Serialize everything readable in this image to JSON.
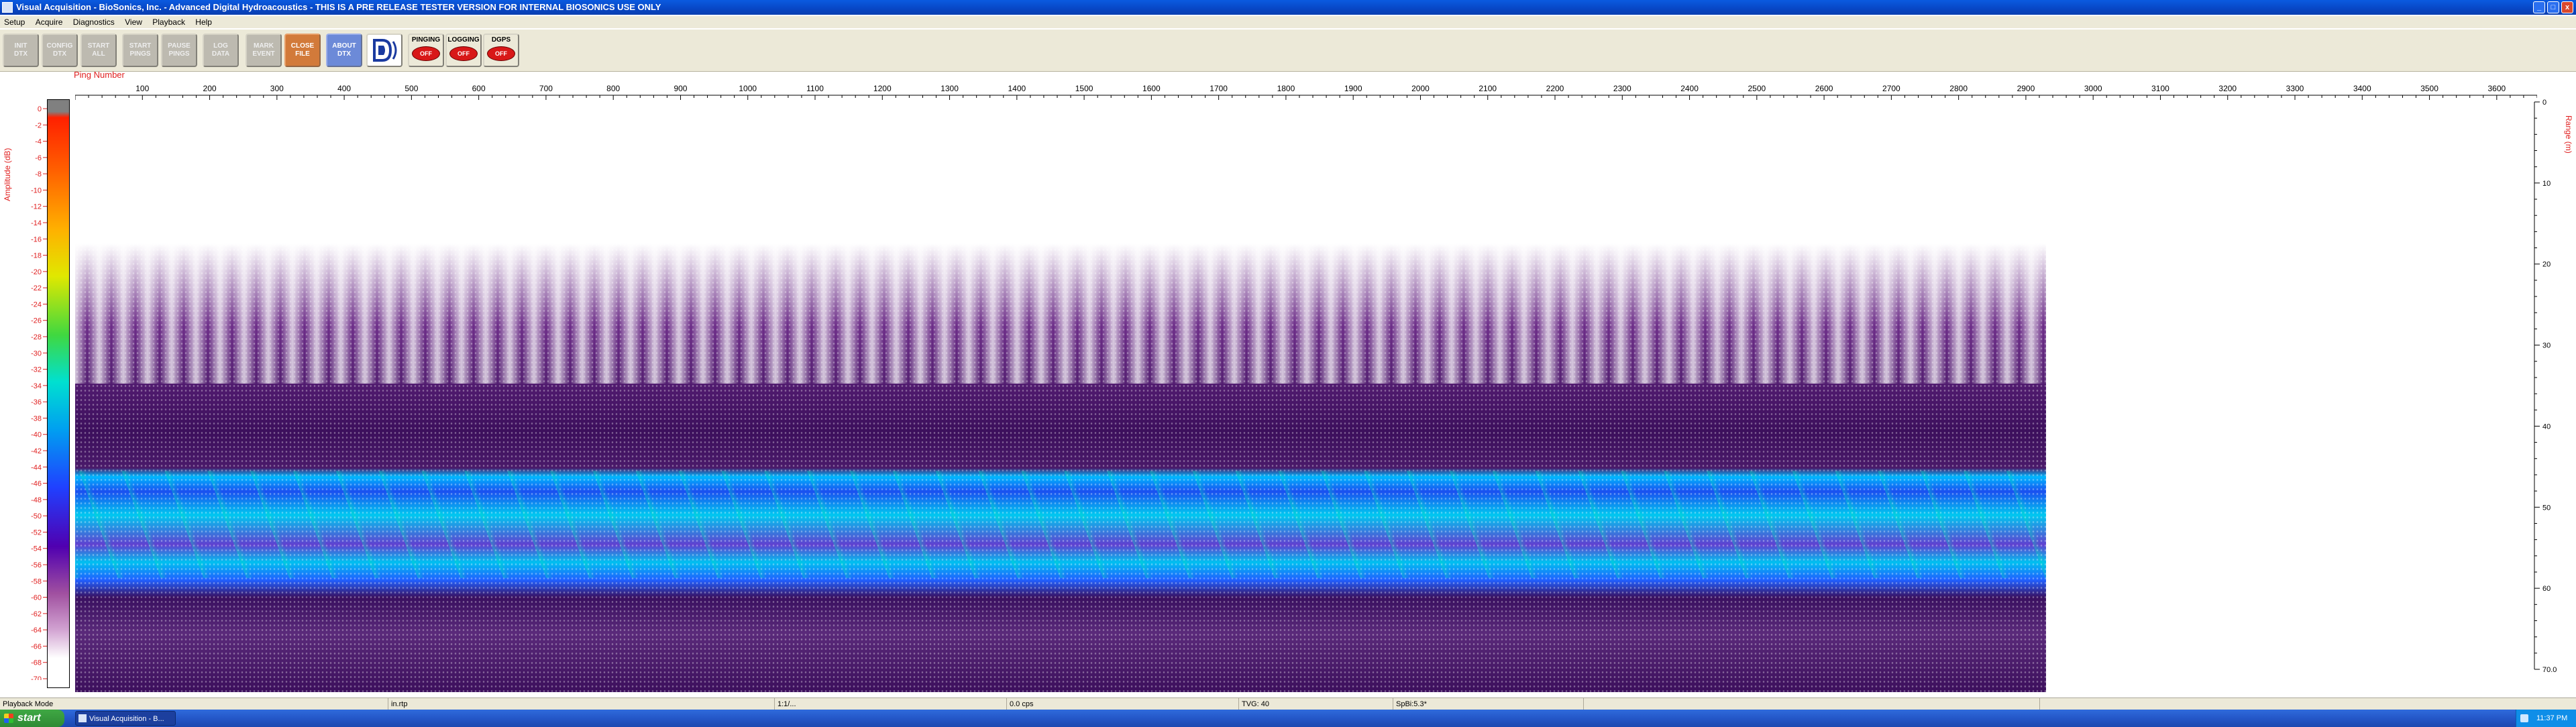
{
  "window": {
    "title": "Visual Acquisition  -  BioSonics, Inc.  -  Advanced Digital Hydroacoustics  -  THIS IS A PRE RELEASE TESTER VERSION FOR INTERNAL BIOSONICS USE ONLY",
    "min_label": "_",
    "max_label": "□",
    "close_label": "x"
  },
  "menu": [
    "Setup",
    "Acquire",
    "Diagnostics",
    "View",
    "Playback",
    "Help"
  ],
  "toolbar": {
    "buttons": [
      {
        "id": "init-dtx",
        "label": "INIT\nDTX"
      },
      {
        "id": "config-dtx",
        "label": "CONFIG\nDTX"
      },
      {
        "id": "start-all",
        "label": "START\nALL"
      },
      {
        "id": "start-pings",
        "label": "START\nPINGS"
      },
      {
        "id": "pause-pings",
        "label": "PAUSE\nPINGS"
      },
      {
        "id": "log-data",
        "label": "LOG\nDATA"
      },
      {
        "id": "mark-event",
        "label": "MARK\nEVENT"
      },
      {
        "id": "close-file",
        "label": "CLOSE\nFILE"
      },
      {
        "id": "about-dtx",
        "label": "ABOUT\nDTX"
      }
    ],
    "indicators": [
      {
        "id": "pinging",
        "label": "PINGING",
        "state": "OFF"
      },
      {
        "id": "logging",
        "label": "LOGGING",
        "state": "OFF"
      },
      {
        "id": "dgps",
        "label": "DGPS",
        "state": "OFF"
      }
    ],
    "colors": {
      "orange": "#d27a3a",
      "blue": "#6c8ad8",
      "indicator_off": "#d81818"
    }
  },
  "echogram": {
    "ping_axis_label": "Ping Number",
    "ping_ticks": [
      100,
      200,
      300,
      400,
      500,
      600,
      700,
      800,
      900,
      1000,
      1100,
      1200,
      1300,
      1400,
      1500,
      1600,
      1700,
      1800,
      1900,
      2000,
      2100,
      2200,
      2300,
      2400,
      2500,
      2600,
      2700,
      2800,
      2900,
      3000,
      3100,
      3200,
      3300,
      3400,
      3500,
      3600
    ],
    "ping_start": 0,
    "ping_end": 3660,
    "data_last_ping": 2930,
    "amplitude_label": "Amplitude (dB)",
    "amplitude_ticks": [
      0,
      -2,
      -4,
      -6,
      -8,
      -10,
      -12,
      -14,
      -16,
      -18,
      -20,
      -22,
      -24,
      -26,
      -28,
      -30,
      -32,
      -34,
      -36,
      -38,
      -40,
      -42,
      -44,
      -46,
      -48,
      -50,
      -52,
      -54,
      -56,
      -58,
      -60,
      -62,
      -64,
      -66,
      -68,
      -70
    ],
    "range_label": "Range (m)",
    "range_ticks": [
      "0",
      "10",
      "20",
      "30",
      "40",
      "50",
      "60",
      "70.0"
    ],
    "range_max": 70
  },
  "statusbar": {
    "mode": "Playback Mode",
    "field2": "in.rtp",
    "field3": "1:1/...",
    "field4": "0.0 cps",
    "field5": "TVG: 40",
    "field6": "SpBi:5.3*"
  },
  "taskbar": {
    "start_label": "start",
    "task_item": "Visual Acquisition - B...",
    "clock": "11:37 PM"
  }
}
